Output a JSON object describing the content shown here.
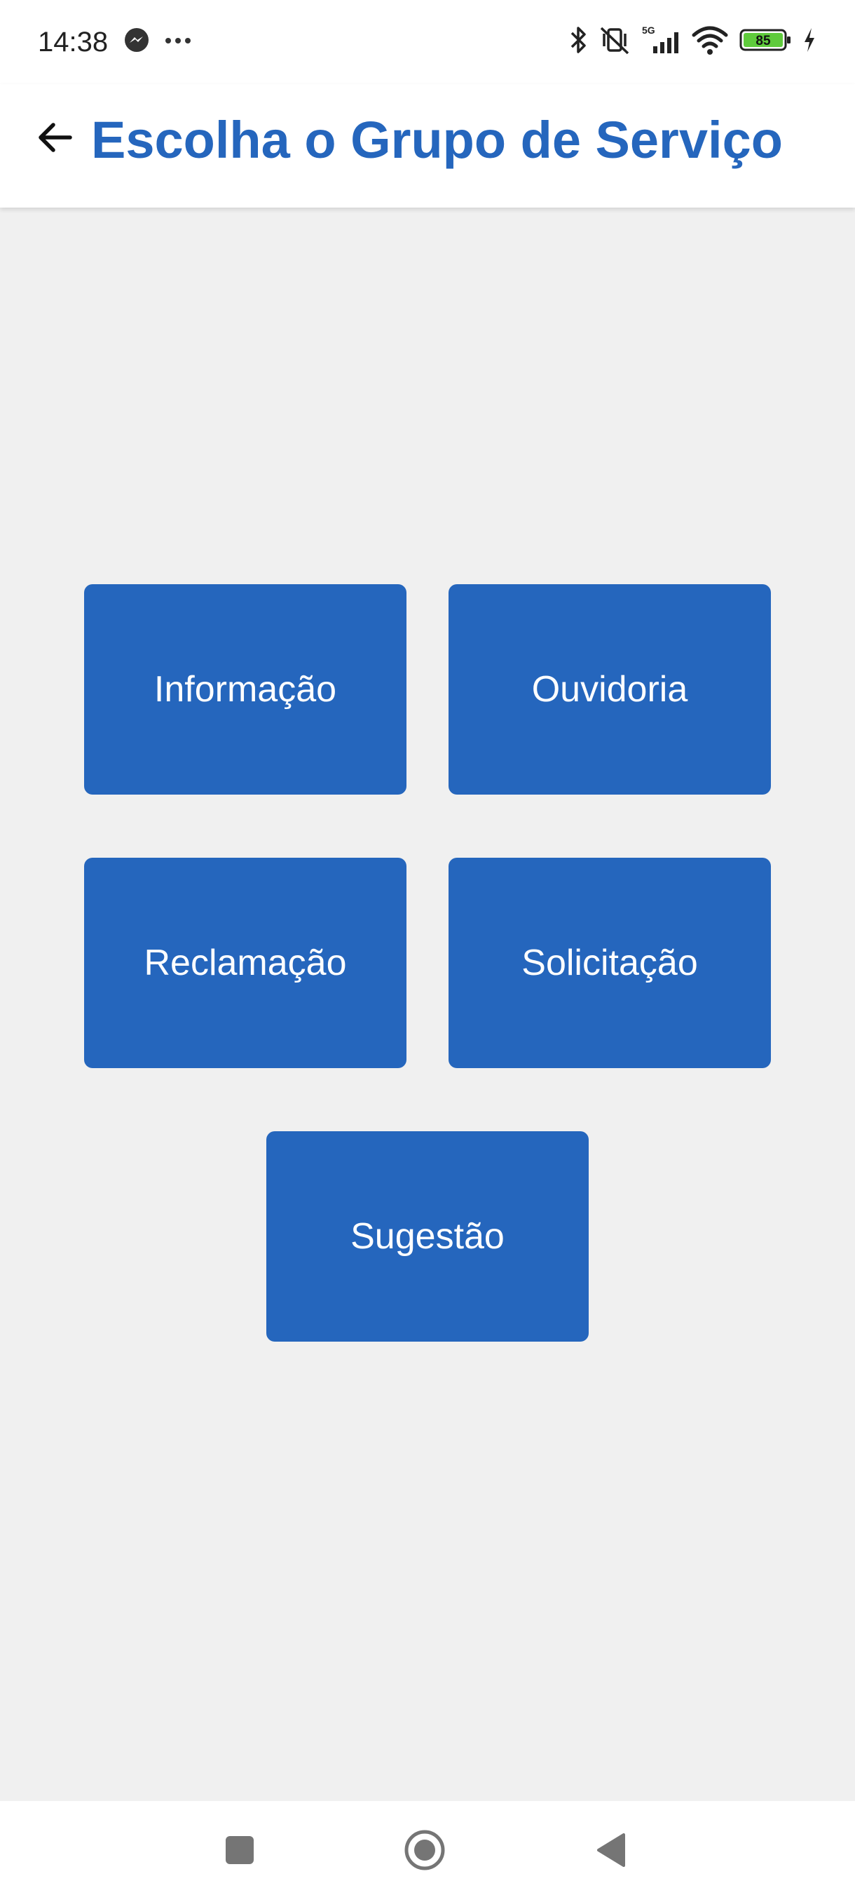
{
  "status_bar": {
    "time": "14:38",
    "battery_level": "85",
    "network": "5G"
  },
  "app_bar": {
    "title": "Escolha o Grupo de Serviço"
  },
  "service_groups": [
    {
      "label": "Informação"
    },
    {
      "label": "Ouvidoria"
    },
    {
      "label": "Reclamação"
    },
    {
      "label": "Solicitação"
    },
    {
      "label": "Sugestão"
    }
  ],
  "colors": {
    "primary": "#2566bd",
    "background": "#f0f0f0",
    "battery": "#5fcb3c"
  },
  "icons": {
    "back": "arrow-left-icon",
    "messenger": "messenger-icon",
    "more": "more-dots-icon",
    "bluetooth": "bluetooth-icon",
    "mute": "vibrate-off-icon",
    "signal": "signal-icon",
    "wifi": "wifi-icon",
    "battery": "battery-icon",
    "charging": "charging-bolt-icon",
    "nav_recent": "square-recents-icon",
    "nav_home": "circle-home-icon",
    "nav_back": "triangle-back-icon"
  }
}
